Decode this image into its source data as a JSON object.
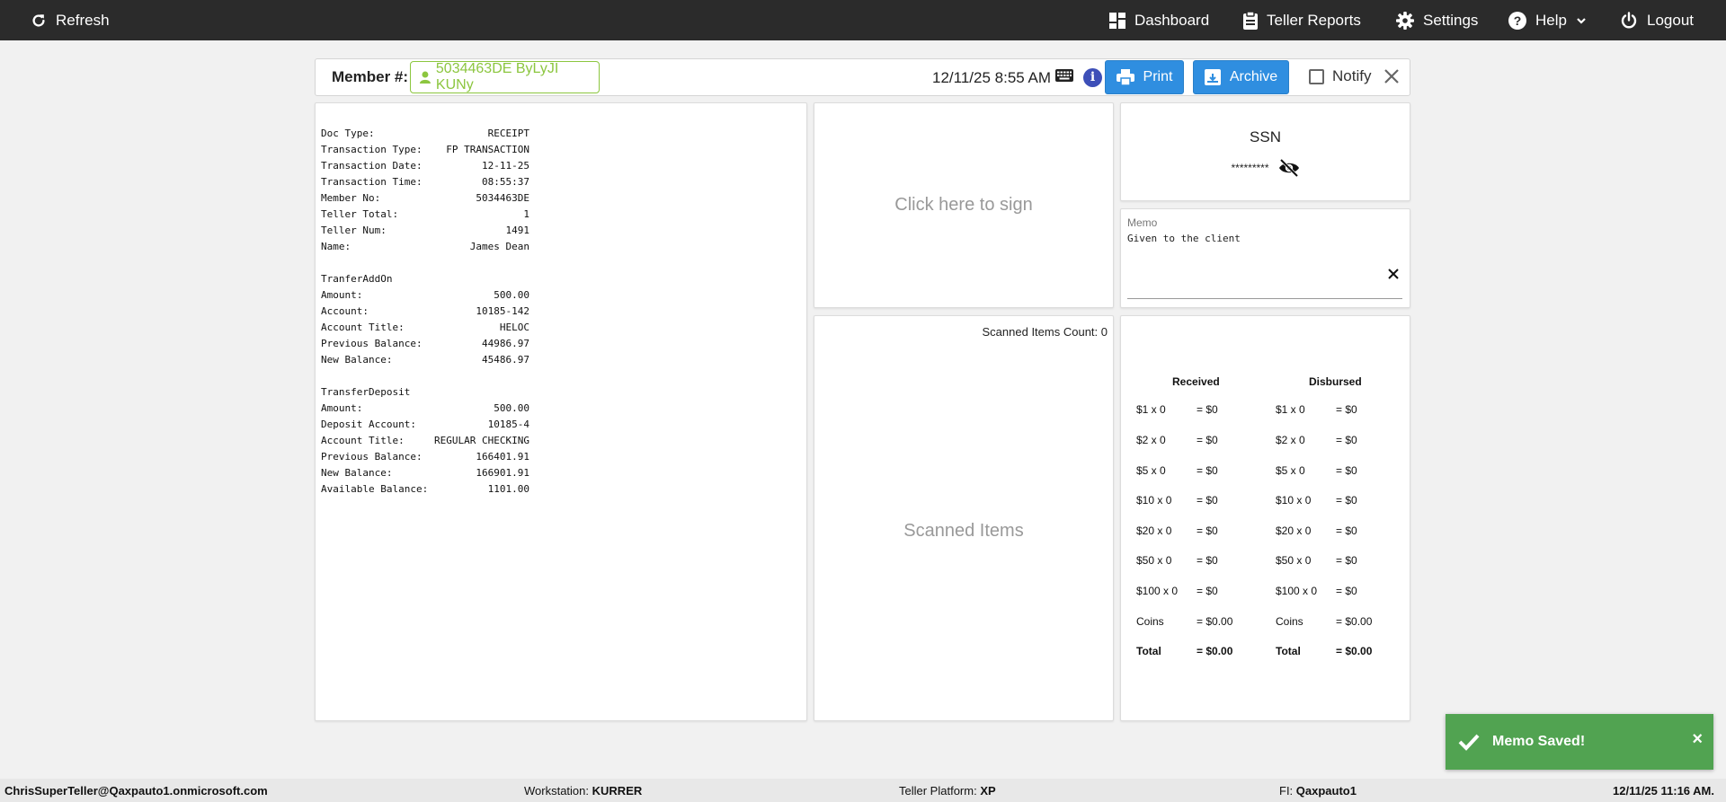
{
  "nav": {
    "refresh_label": "Refresh",
    "dashboard_label": "Dashboard",
    "teller_reports_label": "Teller Reports",
    "settings_label": "Settings",
    "help_label": "Help",
    "logout_label": "Logout"
  },
  "toolbar": {
    "member_label": "Member #:",
    "member_value": "5034463DE ByLyJI KUNy",
    "datetime": "12/11/25 8:55 AM",
    "info_glyph": "i",
    "print_label": "Print",
    "archive_label": "Archive",
    "notify_label": "Notify",
    "notify_checked": false
  },
  "receipt": {
    "header": [
      {
        "label": "Doc Type:",
        "value": "RECEIPT"
      },
      {
        "label": "Transaction Type:",
        "value": "FP TRANSACTION"
      },
      {
        "label": "Transaction Date:",
        "value": "12-11-25"
      },
      {
        "label": "Transaction Time:",
        "value": "08:55:37"
      },
      {
        "label": "Member No:",
        "value": "5034463DE"
      },
      {
        "label": "Teller Total:",
        "value": "1"
      },
      {
        "label": "Teller Num:",
        "value": "1491"
      },
      {
        "label": "Name:",
        "value": "James Dean"
      }
    ],
    "transfer_addon": {
      "title": "TranferAddOn",
      "lines": [
        {
          "label": "Amount:",
          "value": "500.00"
        },
        {
          "label": "Account:",
          "value": "10185-142"
        },
        {
          "label": "Account Title:",
          "value": "HELOC"
        },
        {
          "label": "Previous Balance:",
          "value": "44986.97"
        },
        {
          "label": "New Balance:",
          "value": "45486.97"
        }
      ]
    },
    "transfer_deposit": {
      "title": "TransferDeposit",
      "lines": [
        {
          "label": "Amount:",
          "value": "500.00"
        },
        {
          "label": "Deposit Account:",
          "value": "10185-4"
        },
        {
          "label": "Account Title:",
          "value": "REGULAR CHECKING"
        },
        {
          "label": "Previous Balance:",
          "value": "166401.91"
        },
        {
          "label": "New Balance:",
          "value": "166901.91"
        },
        {
          "label": "Available Balance:",
          "value": "1101.00"
        }
      ]
    }
  },
  "signature": {
    "prompt": "Click here to sign"
  },
  "scanned": {
    "count_label": "Scanned Items Count: 0",
    "title": "Scanned Items"
  },
  "ssn": {
    "title": "SSN",
    "masked_value": "*********"
  },
  "memo": {
    "label": "Memo",
    "value": "Given to the client"
  },
  "cash": {
    "received_header": "Received",
    "disbursed_header": "Disbursed",
    "rows": [
      {
        "received_denom": "$1 x 0",
        "received_total": "= $0",
        "disbursed_denom": "$1 x 0",
        "disbursed_total": "= $0"
      },
      {
        "received_denom": "$2 x 0",
        "received_total": "= $0",
        "disbursed_denom": "$2 x 0",
        "disbursed_total": "= $0"
      },
      {
        "received_denom": "$5 x 0",
        "received_total": "= $0",
        "disbursed_denom": "$5 x 0",
        "disbursed_total": "= $0"
      },
      {
        "received_denom": "$10 x 0",
        "received_total": "= $0",
        "disbursed_denom": "$10 x 0",
        "disbursed_total": "= $0"
      },
      {
        "received_denom": "$20 x 0",
        "received_total": "= $0",
        "disbursed_denom": "$20 x 0",
        "disbursed_total": "= $0"
      },
      {
        "received_denom": "$50 x 0",
        "received_total": "= $0",
        "disbursed_denom": "$50 x 0",
        "disbursed_total": "= $0"
      },
      {
        "received_denom": "$100 x 0",
        "received_total": "= $0",
        "disbursed_denom": "$100 x 0",
        "disbursed_total": "= $0"
      },
      {
        "received_denom": "Coins",
        "received_total": "= $0.00",
        "disbursed_denom": "Coins",
        "disbursed_total": "= $0.00"
      },
      {
        "received_denom": "Total",
        "received_total": "= $0.00",
        "disbursed_denom": "Total",
        "disbursed_total": "= $0.00"
      }
    ]
  },
  "status": {
    "user": "ChrisSuperTeller@Qaxpauto1.onmicrosoft.com",
    "workstation_label": "Workstation:",
    "workstation_value": "KURRER",
    "platform_label": "Teller Platform:",
    "platform_value": "XP",
    "fi_label": "FI:",
    "fi_value": "Qaxpauto1",
    "datetime": "12/11/25 11:16 AM."
  },
  "toast": {
    "message": "Memo Saved!",
    "close_glyph": "×"
  },
  "colors": {
    "nav_bg": "#2b2b2b",
    "primary_button": "#2f8ee0",
    "member_green": "#8cc63f",
    "toast_green": "#51a351",
    "info_blue": "#3d4fb8"
  },
  "icons": {
    "refresh": "refresh-icon",
    "dashboard": "dashboard-icon",
    "teller_reports": "clipboard-icon",
    "settings": "gear-icon",
    "help": "question-circle-icon",
    "logout": "power-icon",
    "member": "user-icon",
    "keyboard": "keyboard-icon",
    "info": "info-icon",
    "print": "print-icon",
    "archive": "archive-icon",
    "close": "close-icon",
    "visibility": "eye-slash-icon",
    "toast": "checkmark-icon"
  }
}
